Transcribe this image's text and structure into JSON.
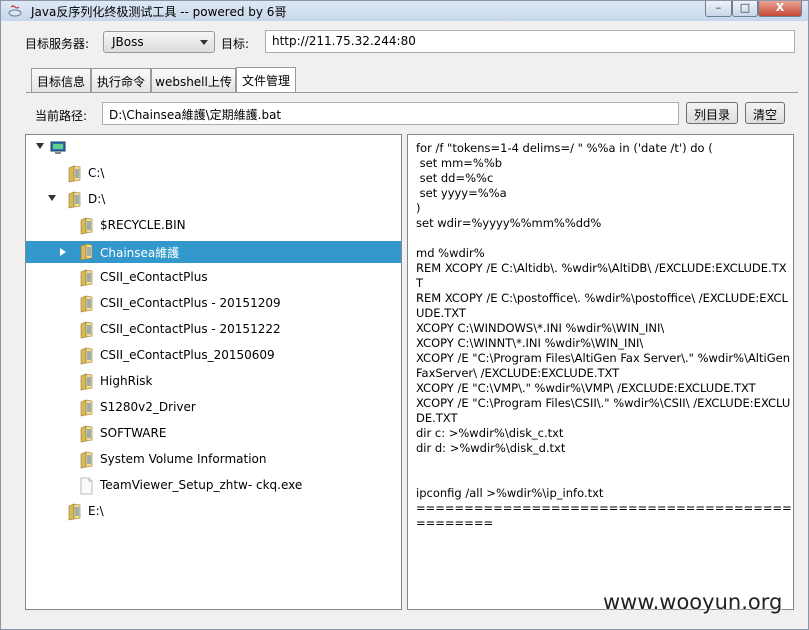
{
  "window": {
    "title": "Java反序列化终极测试工具 -- powered by 6哥",
    "min_label": "–",
    "max_label": "□",
    "close_label": "X"
  },
  "target_bar": {
    "server_label": "目标服务器:",
    "server_value": "JBoss",
    "target_label": "目标:",
    "target_value": "http://211.75.32.244:80"
  },
  "tabs": [
    {
      "label": "目标信息"
    },
    {
      "label": "执行命令"
    },
    {
      "label": "webshell上传"
    },
    {
      "label": "文件管理"
    }
  ],
  "path_bar": {
    "label": "当前路径:",
    "value": "D:\\Chainsea維護\\定期維護.bat",
    "list_button": "列目录",
    "clear_button": "清空"
  },
  "tree": [
    {
      "label": "",
      "level": 0,
      "icon": "computer-icon",
      "expand": "down"
    },
    {
      "label": "C:\\",
      "level": 1,
      "icon": "folder-icon",
      "expand": ""
    },
    {
      "label": "D:\\",
      "level": 1,
      "icon": "folder-icon",
      "expand": "down"
    },
    {
      "label": "$RECYCLE.BIN",
      "level": 2,
      "icon": "folder-icon",
      "expand": ""
    },
    {
      "label": "Chainsea維護",
      "level": 2,
      "icon": "folder-icon",
      "expand": "right",
      "selected": true
    },
    {
      "label": "CSII_eContactPlus",
      "level": 2,
      "icon": "folder-icon",
      "expand": ""
    },
    {
      "label": "CSII_eContactPlus - 20151209",
      "level": 2,
      "icon": "folder-icon",
      "expand": ""
    },
    {
      "label": "CSII_eContactPlus - 20151222",
      "level": 2,
      "icon": "folder-icon",
      "expand": ""
    },
    {
      "label": "CSII_eContactPlus_20150609",
      "level": 2,
      "icon": "folder-icon",
      "expand": ""
    },
    {
      "label": "HighRisk",
      "level": 2,
      "icon": "folder-icon",
      "expand": ""
    },
    {
      "label": "S1280v2_Driver",
      "level": 2,
      "icon": "folder-icon",
      "expand": ""
    },
    {
      "label": "SOFTWARE",
      "level": 2,
      "icon": "folder-icon",
      "expand": ""
    },
    {
      "label": "System Volume Information",
      "level": 2,
      "icon": "folder-icon",
      "expand": ""
    },
    {
      "label": "TeamViewer_Setup_zhtw- ckq.exe",
      "level": 2,
      "icon": "file-icon",
      "expand": ""
    },
    {
      "label": "E:\\",
      "level": 1,
      "icon": "folder-icon",
      "expand": ""
    }
  ],
  "file_content": "for /f \"tokens=1-4 delims=/ \" %%a in ('date /t') do (\n set mm=%%b\n set dd=%%c\n set yyyy=%%a\n)\nset wdir=%yyyy%%mm%%dd%\n\nmd %wdir%\nREM XCOPY /E C:\\Altidb\\. %wdir%\\AltiDB\\ /EXCLUDE:EXCLUDE.TXT\nREM XCOPY /E C:\\postoffice\\. %wdir%\\postoffice\\ /EXCLUDE:EXCLUDE.TXT\nXCOPY C:\\WINDOWS\\*.INI %wdir%\\WIN_INI\\\nXCOPY C:\\WINNT\\*.INI %wdir%\\WIN_INI\\\nXCOPY /E \"C:\\Program Files\\AltiGen Fax Server\\.\" %wdir%\\AltiGenFaxServer\\ /EXCLUDE:EXCLUDE.TXT\nXCOPY /E \"C:\\VMP\\.\" %wdir%\\VMP\\ /EXCLUDE:EXCLUDE.TXT\nXCOPY /E \"C:\\Program Files\\CSII\\.\" %wdir%\\CSII\\ /EXCLUDE:EXCLUDE.TXT\ndir c: >%wdir%\\disk_c.txt\ndir d: >%wdir%\\disk_d.txt\n\n\nipconfig /all >%wdir%\\ip_info.txt\n===============================================",
  "watermark": "www.wooyun.org"
}
